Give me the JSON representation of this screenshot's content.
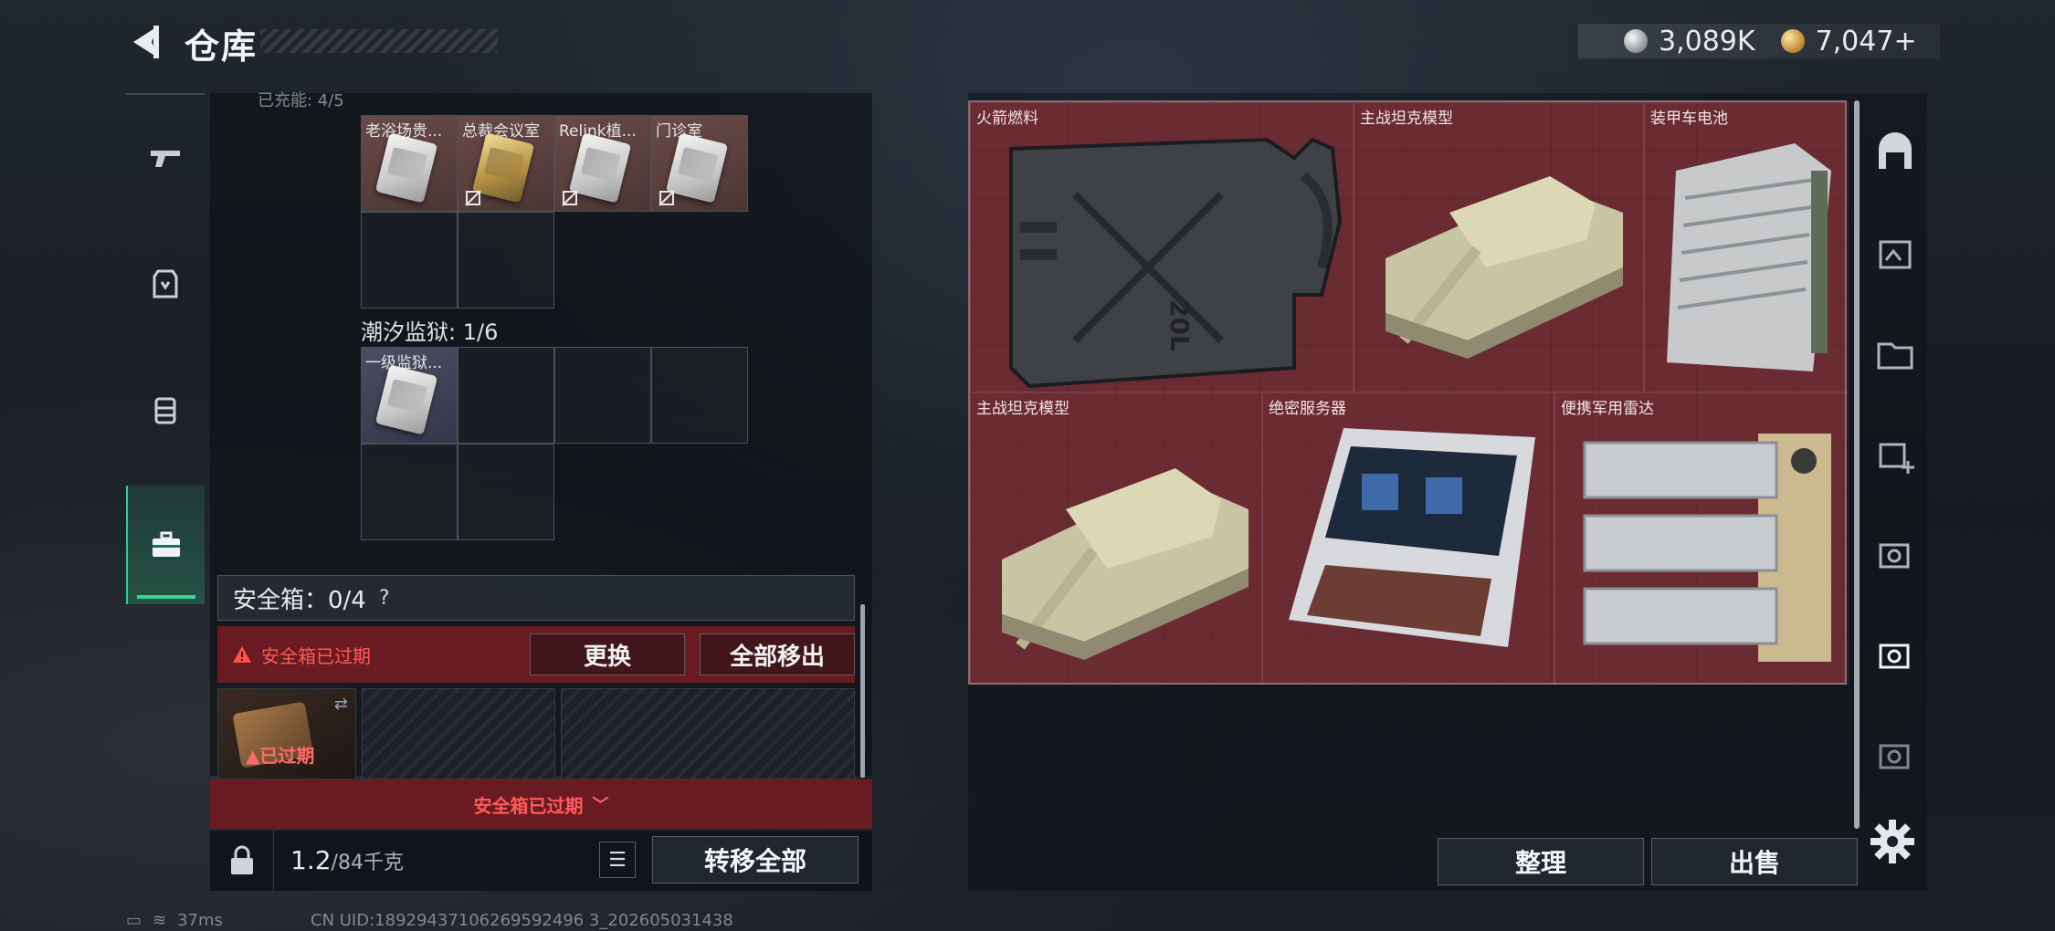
{
  "header": {
    "title": "仓库",
    "currency_silver": "3,089K",
    "currency_gold": "7,047+"
  },
  "left_panel": {
    "top_cut_label": "已充能: 4/5",
    "group1_items": [
      {
        "label": "老浴场贵...",
        "style": "silver",
        "no_carry": false
      },
      {
        "label": "总裁会议室",
        "style": "gold",
        "no_carry": true
      },
      {
        "label": "Relink植...",
        "style": "silver",
        "no_carry": true
      },
      {
        "label": "门诊室",
        "style": "silver",
        "no_carry": true
      }
    ],
    "group2_title": "潮汐监狱: 1/6",
    "group2_items": [
      {
        "label": "一级监狱...",
        "style": "silver"
      }
    ],
    "safe_box": {
      "label": "安全箱：0/4",
      "help": "?",
      "expired_text": "安全箱已过期",
      "replace_button": "更换",
      "remove_all_button": "全部移出",
      "case_expired_label": "已过期",
      "footer_text": "安全箱已过期"
    },
    "weight_current": "1.2",
    "weight_max": "/84千克",
    "transfer_all_button": "转移全部"
  },
  "right_panel": {
    "items": [
      {
        "label": "火箭燃料"
      },
      {
        "label": "主战坦克模型"
      },
      {
        "label": "装甲车电池"
      },
      {
        "label": "主战坦克模型"
      },
      {
        "label": "绝密服务器"
      },
      {
        "label": "便携军用雷达"
      }
    ],
    "jerrycan_text": "20L",
    "sort_button": "整理",
    "sell_button": "出售"
  },
  "status_bar": {
    "ping": "37ms",
    "uid": "CN UID:18929437106269592496 3_202605031438"
  },
  "colors": {
    "accent_green": "#31d89a",
    "expired_red": "#ff5a5a",
    "item_bg": "#6b2b33"
  }
}
